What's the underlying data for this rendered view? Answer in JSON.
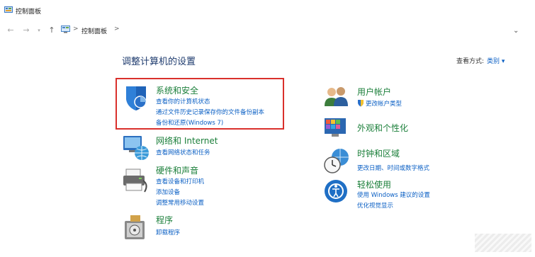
{
  "window": {
    "title": "控制面板"
  },
  "nav": {
    "back": "←",
    "forward": "→",
    "up": "↑",
    "dropdown": "⌄"
  },
  "address": {
    "sep": ">",
    "crumb": "控制面板"
  },
  "main": {
    "heading": "调整计算机的设置",
    "view_label": "查看方式:",
    "view_value": "类别 ▾"
  },
  "categories": {
    "system": {
      "title": "系统和安全",
      "links": [
        "查看你的计算机状态",
        "通过文件历史记录保存你的文件备份副本",
        "备份和还原(Windows 7)"
      ]
    },
    "network": {
      "title": "网络和 Internet",
      "links": [
        "查看网络状态和任务"
      ]
    },
    "hardware": {
      "title": "硬件和声音",
      "links": [
        "查看设备和打印机",
        "添加设备",
        "调整常用移动设置"
      ]
    },
    "programs": {
      "title": "程序",
      "links": [
        "卸载程序"
      ]
    },
    "users": {
      "title": "用户帐户",
      "links": [
        "更改帐户类型"
      ]
    },
    "appearance": {
      "title": "外观和个性化",
      "links": []
    },
    "clock": {
      "title": "时钟和区域",
      "links": [
        "更改日期、时间或数字格式"
      ]
    },
    "ease": {
      "title": "轻松使用",
      "links": [
        "使用 Windows 建议的设置",
        "优化视觉显示"
      ]
    }
  },
  "colors": {
    "title_green": "#1b7f3a",
    "link_blue": "#0a5fc4",
    "heading_blue": "#1e3b6e",
    "highlight_red": "#d9302c"
  }
}
